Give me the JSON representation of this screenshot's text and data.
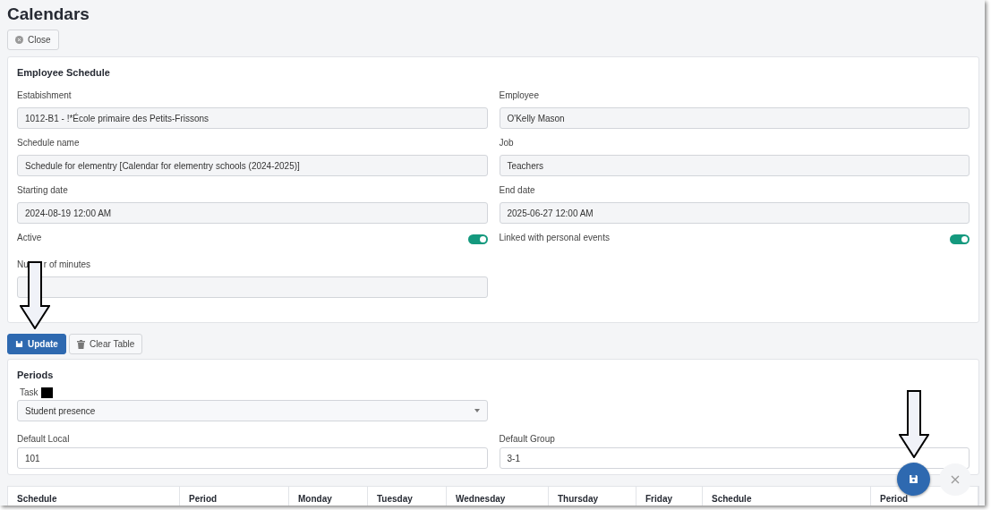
{
  "page": {
    "title": "Calendars",
    "close_button": "Close"
  },
  "employee_schedule": {
    "title": "Employee Schedule",
    "fields": [
      {
        "label": "Estabishment",
        "value": "1012-B1 - !*École primaire des Petits-Frissons"
      },
      {
        "label": "Employee",
        "value": "O'Kelly Mason"
      },
      {
        "label": "Schedule name",
        "value": "Schedule for elementry [Calendar for elementry schools (2024-2025)]"
      },
      {
        "label": "Job",
        "value": "Teachers"
      },
      {
        "label": "Starting date",
        "value": "2024-08-19 12:00 AM"
      },
      {
        "label": "End date",
        "value": "2025-06-27 12:00 AM"
      }
    ],
    "toggles": [
      {
        "label": "Active",
        "on": true
      },
      {
        "label": "Linked with personal events",
        "on": true
      }
    ],
    "minutes_label_parts": [
      "Nu",
      "r of minutes"
    ]
  },
  "actions": [
    {
      "label": "Update",
      "kind": "primary"
    },
    {
      "label": "Clear Table",
      "kind": "secondary"
    }
  ],
  "periods": {
    "title": "Periods",
    "task_label": "Task",
    "task_value": "Student presence",
    "local_label": "Default Local",
    "local_value": "101",
    "group_label": "Default Group",
    "group_value": "3-1"
  },
  "table": {
    "columns": [
      "Schedule",
      "Period",
      "Monday",
      "Tuesday",
      "Wednesday",
      "Thursday",
      "Friday",
      "Schedule",
      "Period"
    ]
  }
}
